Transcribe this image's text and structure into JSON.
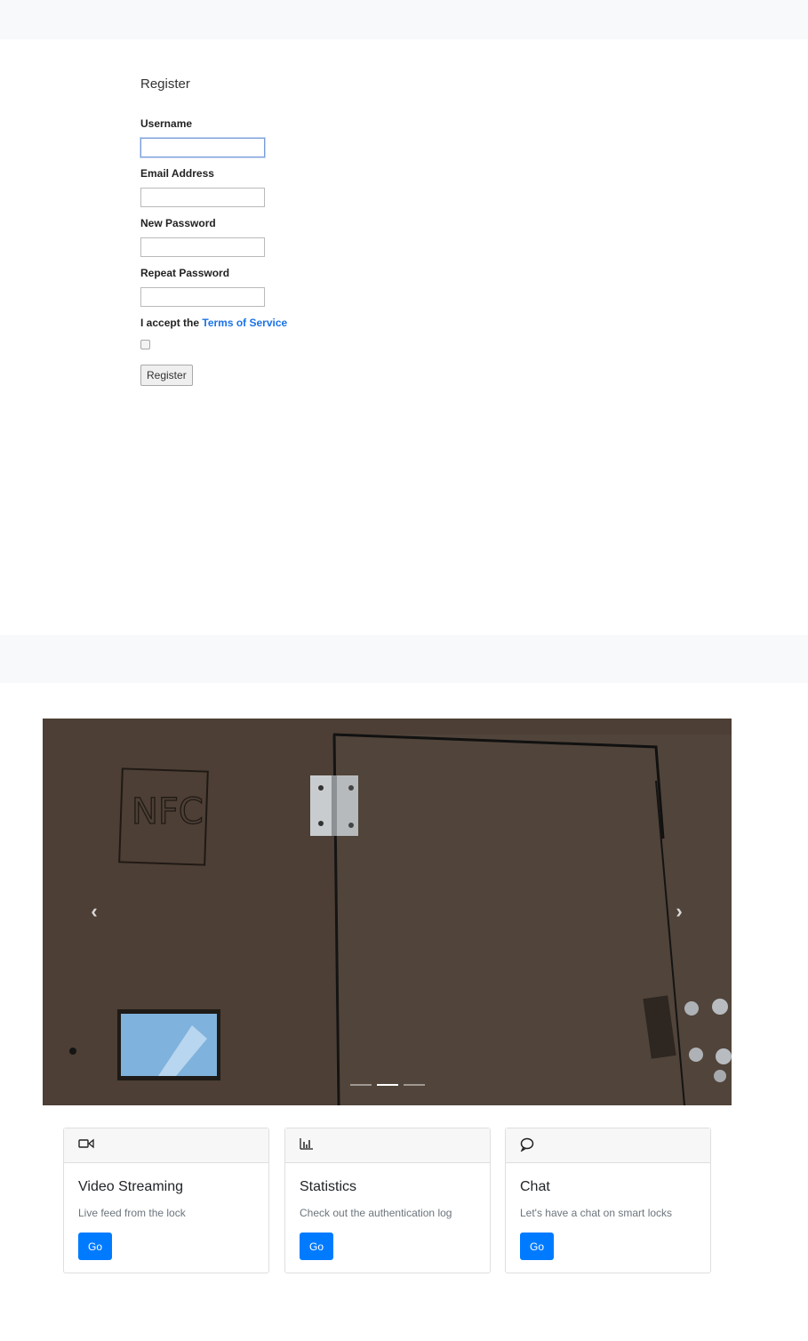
{
  "register": {
    "title": "Register",
    "username_label": "Username",
    "username_value": "",
    "email_label": "Email Address",
    "email_value": "",
    "new_password_label": "New Password",
    "new_password_value": "",
    "repeat_password_label": "Repeat Password",
    "repeat_password_value": "",
    "accept_prefix": "I accept the",
    "terms_link": "Terms of Service",
    "accept_checked": false,
    "submit_label": "Register"
  },
  "carousel": {
    "prev_icon": "chevron-left-icon",
    "next_icon": "chevron-right-icon",
    "image_text": "NFC",
    "indicator_count": 3,
    "active_index": 1
  },
  "cards": [
    {
      "icon": "video-camera-icon",
      "title": "Video Streaming",
      "text": "Live feed from the lock",
      "button": "Go"
    },
    {
      "icon": "bar-chart-icon",
      "title": "Statistics",
      "text": "Check out the authentication log",
      "button": "Go"
    },
    {
      "icon": "chat-bubble-icon",
      "title": "Chat",
      "text": "Let's have a chat on smart locks",
      "button": "Go"
    }
  ],
  "colors": {
    "primary": "#007bff",
    "link": "#1a73e8",
    "bar_bg": "#f8f9fa"
  }
}
